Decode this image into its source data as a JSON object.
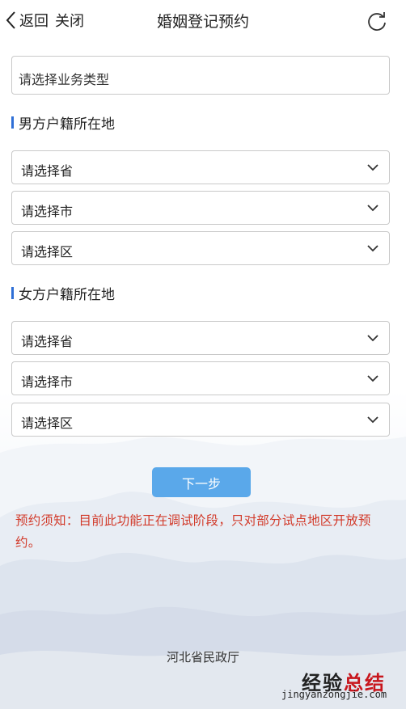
{
  "header": {
    "back_label": "返回",
    "close_label": "关闭",
    "title": "婚姻登记预约"
  },
  "business_type": {
    "placeholder": "请选择业务类型"
  },
  "male_section": {
    "label": "男方户籍所在地",
    "province": "请选择省",
    "city": "请选择市",
    "district": "请选择区"
  },
  "female_section": {
    "label": "女方户籍所在地",
    "province": "请选择省",
    "city": "请选择市",
    "district": "请选择区"
  },
  "next_button": "下一步",
  "notice": "预约须知：目前此功能正在调试阶段，只对部分试点地区开放预约。",
  "footer": {
    "organization": "河北省民政厅"
  },
  "watermark": {
    "brand_a": "经验",
    "brand_b": "总结",
    "url": "jingyanzongjie.com"
  },
  "colors": {
    "accent_bar": "#2f6fd6",
    "button": "#5aa8ea",
    "notice_text": "#d23a2a"
  },
  "icons": [
    "chevron-left-icon",
    "refresh-icon",
    "chevron-down-icon"
  ]
}
